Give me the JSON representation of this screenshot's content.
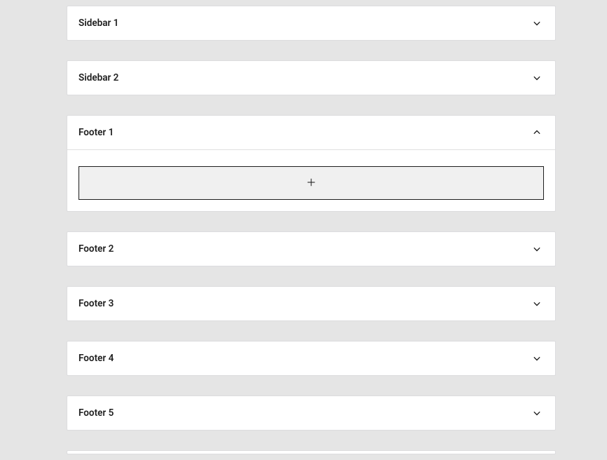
{
  "panels": [
    {
      "label": "Sidebar 1",
      "expanded": false
    },
    {
      "label": "Sidebar 2",
      "expanded": false
    },
    {
      "label": "Footer 1",
      "expanded": true
    },
    {
      "label": "Footer 2",
      "expanded": false
    },
    {
      "label": "Footer 3",
      "expanded": false
    },
    {
      "label": "Footer 4",
      "expanded": false
    },
    {
      "label": "Footer 5",
      "expanded": false
    }
  ]
}
